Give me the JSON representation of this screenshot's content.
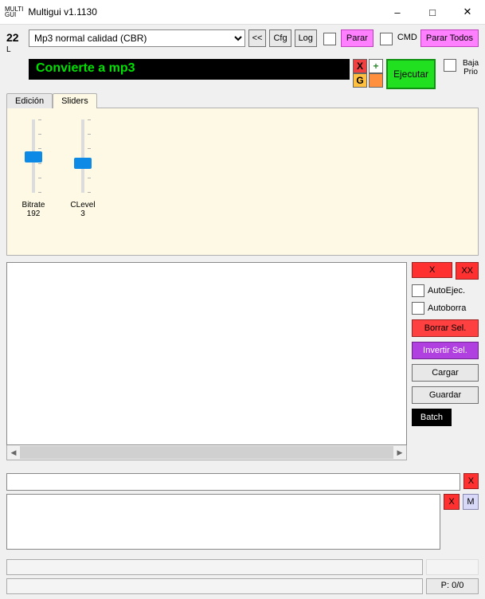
{
  "window": {
    "logo_line1": "MULTI",
    "logo_line2": "GUI",
    "title": "Multigui v1.1130"
  },
  "header": {
    "number": "22",
    "number_sub": "L",
    "preset": "Mp3 normal calidad (CBR)",
    "btn_prev": "<<",
    "btn_cfg": "Cfg",
    "btn_log": "Log",
    "btn_parar": "Parar",
    "lbl_cmd": "CMD",
    "btn_parar_todos": "Parar Todos"
  },
  "subheader": {
    "title": "Convierte a mp3",
    "icon_x": "X",
    "icon_plus": "+",
    "icon_g": "G",
    "btn_ejecutar": "Ejecutar",
    "lbl_baja": "Baja",
    "lbl_prio": "Prio"
  },
  "tabs": {
    "edicion": "Edición",
    "sliders": "Sliders",
    "active": "sliders"
  },
  "sliders": {
    "bitrate_label": "Bitrate",
    "bitrate_value": "192",
    "clevel_label": "CLevel",
    "clevel_value": "3"
  },
  "side": {
    "btn_x": "X",
    "btn_xx": "XX",
    "lbl_autoejec": "AutoEjec.",
    "lbl_autoborra": "Autoborra",
    "btn_borrar_sel": "Borrar Sel.",
    "btn_invertir_sel": "Invertir Sel.",
    "btn_cargar": "Cargar",
    "btn_guardar": "Guardar",
    "btn_batch": "Batch"
  },
  "lower": {
    "btn_x": "X",
    "btn_m": "M"
  },
  "status": {
    "p": "P: 0/0"
  }
}
